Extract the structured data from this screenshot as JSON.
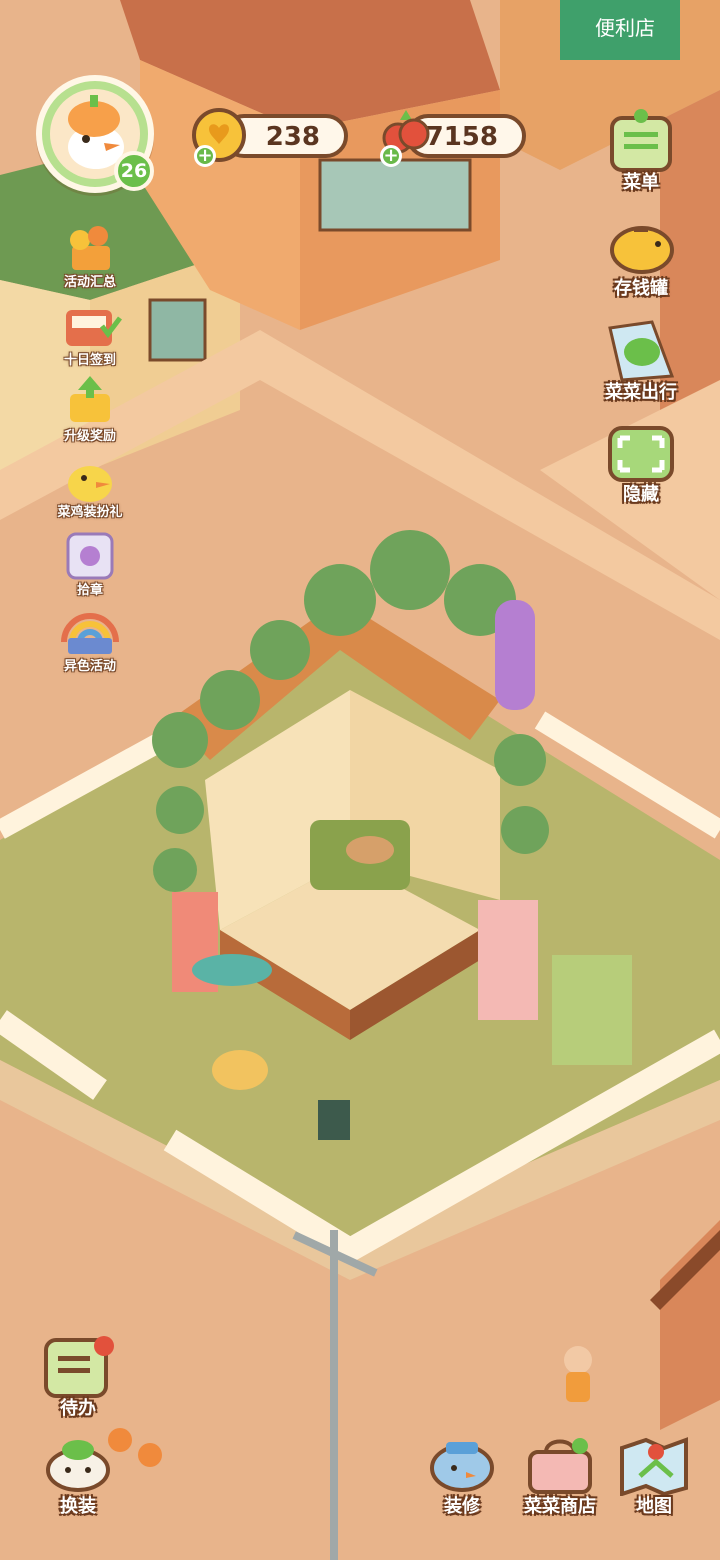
{
  "player": {
    "level": "26"
  },
  "currency": {
    "coins": "238",
    "veggies": "7158"
  },
  "left_menu": [
    {
      "label": "活动汇总",
      "icon": "flower-pot-icon"
    },
    {
      "label": "十日签到",
      "icon": "calendar-basket-icon"
    },
    {
      "label": "升级奖励",
      "icon": "level-up-reward-icon"
    },
    {
      "label": "菜鸡装扮礼",
      "icon": "duck-costume-icon"
    },
    {
      "label": "拾章",
      "icon": "stamp-collection-icon"
    },
    {
      "label": "异色活动",
      "icon": "rainbow-book-icon"
    }
  ],
  "right_menu": [
    {
      "label": "菜单",
      "icon": "menu-icon"
    },
    {
      "label": "存钱罐",
      "icon": "piggy-bank-icon"
    },
    {
      "label": "菜菜出行",
      "icon": "travel-map-icon"
    },
    {
      "label": "隐藏",
      "icon": "hide-frame-icon"
    }
  ],
  "bottom_left": [
    {
      "label": "待办",
      "icon": "todo-list-icon"
    },
    {
      "label": "换装",
      "icon": "wardrobe-icon"
    }
  ],
  "bottom_right": [
    {
      "label": "装修",
      "icon": "decorate-bird-icon"
    },
    {
      "label": "菜菜商店",
      "icon": "shop-bag-icon"
    },
    {
      "label": "地图",
      "icon": "map-icon"
    }
  ],
  "signs": {
    "store": "便利店"
  },
  "colors": {
    "road": "#e9b48a",
    "grass": "#b8b56c",
    "accent_green": "#69b94a",
    "outline_brown": "#7a4a2b"
  }
}
